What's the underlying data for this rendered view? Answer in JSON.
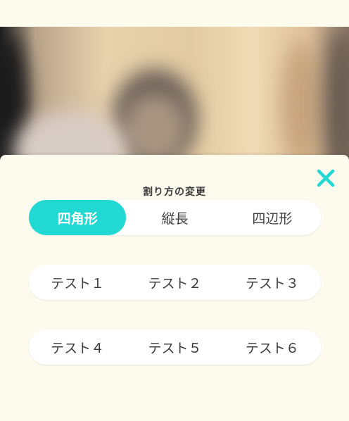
{
  "modal": {
    "title": "割り方の変更",
    "close_icon": "close-icon",
    "accent_color": "#22d8d3"
  },
  "split_modes": [
    {
      "label": "四角形",
      "selected": true
    },
    {
      "label": "縦長",
      "selected": false
    },
    {
      "label": "四辺形",
      "selected": false
    }
  ],
  "test_rows": [
    [
      "テスト１",
      "テスト２",
      "テスト３"
    ],
    [
      "テスト４",
      "テスト５",
      "テスト６"
    ]
  ]
}
